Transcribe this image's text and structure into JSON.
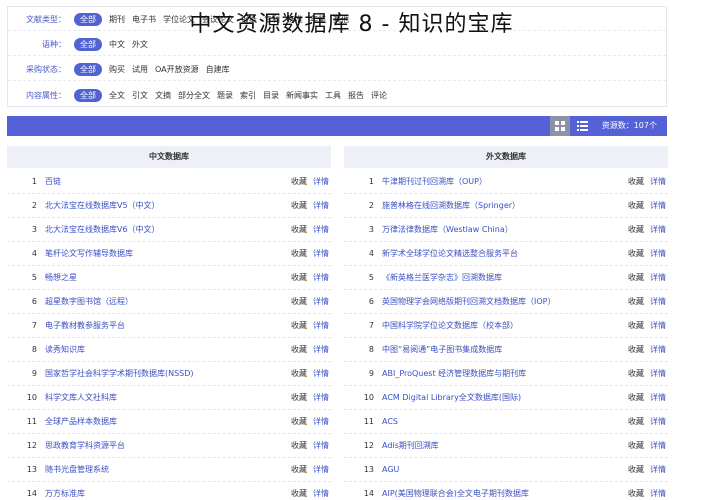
{
  "overlay_title": "中文资源数据库 8 - 知识的宝库",
  "filters": [
    {
      "label": "文献类型：",
      "all": "全部",
      "options": [
        "期刊",
        "电子书",
        "学位论文",
        "会议论文",
        "报纸",
        "专利",
        "标准",
        "年鉴",
        "其他"
      ]
    },
    {
      "label": "语种：",
      "all": "全部",
      "options": [
        "中文",
        "外文"
      ]
    },
    {
      "label": "采购状态：",
      "all": "全部",
      "options": [
        "购买",
        "试用",
        "OA开放资源",
        "自建库"
      ]
    },
    {
      "label": "内容属性：",
      "all": "全部",
      "options": [
        "全文",
        "引文",
        "文摘",
        "部分全文",
        "题录",
        "索引",
        "目录",
        "新闻事实",
        "工具",
        "报告",
        "评论"
      ]
    }
  ],
  "toolbar": {
    "grid_icon": "grid-view-icon",
    "list_icon": "list-view-icon",
    "count_label": "资源数：107个"
  },
  "action_labels": {
    "favorite": "收藏",
    "detail": "详情"
  },
  "left_column": {
    "header": "中文数据库",
    "rows": [
      {
        "num": "1",
        "name": "百链"
      },
      {
        "num": "2",
        "name": "北大法宝在线数据库V5（中文）"
      },
      {
        "num": "3",
        "name": "北大法宝在线数据库V6（中文）"
      },
      {
        "num": "4",
        "name": "笔杆论文写作辅导数据库"
      },
      {
        "num": "5",
        "name": "畅想之星"
      },
      {
        "num": "6",
        "name": "超星数字图书馆（远程）"
      },
      {
        "num": "7",
        "name": "电子教材教参服务平台"
      },
      {
        "num": "8",
        "name": "读秀知识库"
      },
      {
        "num": "9",
        "name": "国家哲学社会科学学术期刊数据库(NSSD)"
      },
      {
        "num": "10",
        "name": "科学文库人文社科库"
      },
      {
        "num": "11",
        "name": "全球产品样本数据库"
      },
      {
        "num": "12",
        "name": "思政教育学科资源平台"
      },
      {
        "num": "13",
        "name": "随书光盘管理系统"
      },
      {
        "num": "14",
        "name": "万方标准库"
      }
    ]
  },
  "right_column": {
    "header": "外文数据库",
    "rows": [
      {
        "num": "1",
        "name": "牛津期刊过刊回溯库（OUP）"
      },
      {
        "num": "2",
        "name": "施普林格在线回溯数据库（Springer）"
      },
      {
        "num": "3",
        "name": "万律法律数据库（Westlaw China）"
      },
      {
        "num": "4",
        "name": "新学术全球学位论文精选整合服务平台"
      },
      {
        "num": "5",
        "name": "《新英格兰医学杂志》回溯数据库"
      },
      {
        "num": "6",
        "name": "英国物理学会网络版期刊回溯文档数据库（IOP）"
      },
      {
        "num": "7",
        "name": "中国科学院学位论文数据库（校本部）"
      },
      {
        "num": "8",
        "name": "中图“易阅通”电子图书集成数据库"
      },
      {
        "num": "9",
        "name": "ABI_ProQuest 经济管理数据库与期刊库"
      },
      {
        "num": "10",
        "name": "ACM Digital Library全文数据库(国际)"
      },
      {
        "num": "11",
        "name": "ACS"
      },
      {
        "num": "12",
        "name": "Adis期刊回溯库"
      },
      {
        "num": "13",
        "name": "AGU"
      },
      {
        "num": "14",
        "name": "AIP(美国物理联合会)全文电子期刊数据库"
      }
    ]
  }
}
